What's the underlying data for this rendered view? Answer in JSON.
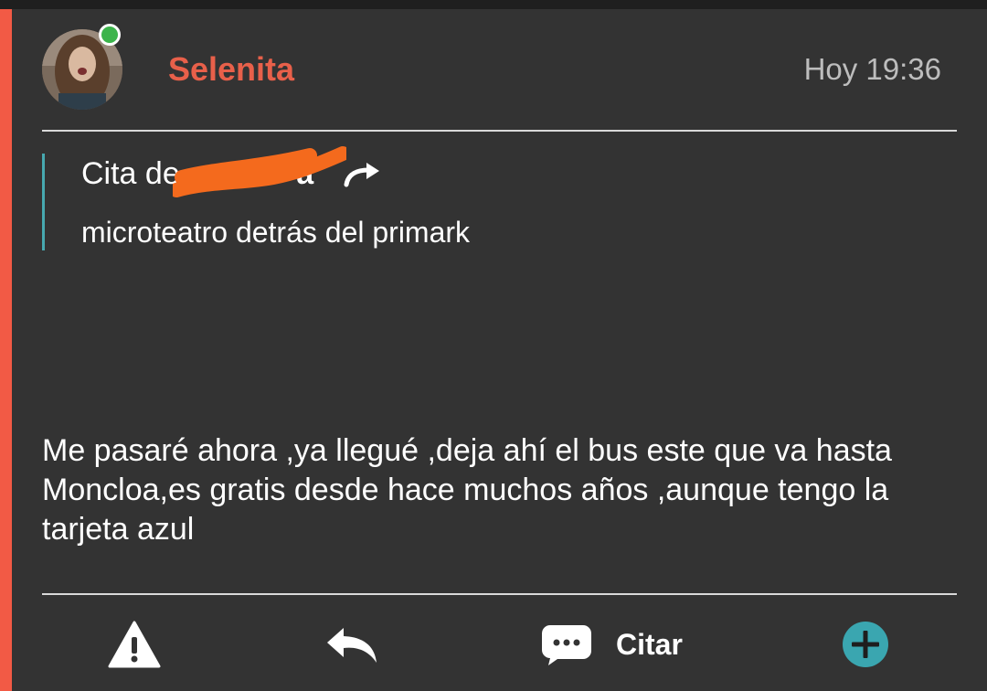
{
  "post": {
    "username": "Selenita",
    "timestamp": "Hoy 19:36",
    "quote": {
      "prefix": "Cita de ",
      "author_visible": "a",
      "text": "microteatro detrás del primark"
    },
    "message": "Me pasaré ahora ,ya llegué ,deja ahí el bus este que va hasta Moncloa,es gratis desde hace muchos años ,aunque tengo la tarjeta azul"
  },
  "actions": {
    "report_icon": "warning-icon",
    "reply_icon": "reply-icon",
    "quote_icon": "chat-bubble-icon",
    "quote_label": "Citar",
    "more_icon": "plus-circle-icon"
  },
  "colors": {
    "accent": "#f25a45",
    "username": "#e8604a",
    "online": "#3cb44b",
    "quote_border": "#47a9b0",
    "plus_button": "#3aa6b0",
    "redaction": "#f46a1d"
  }
}
